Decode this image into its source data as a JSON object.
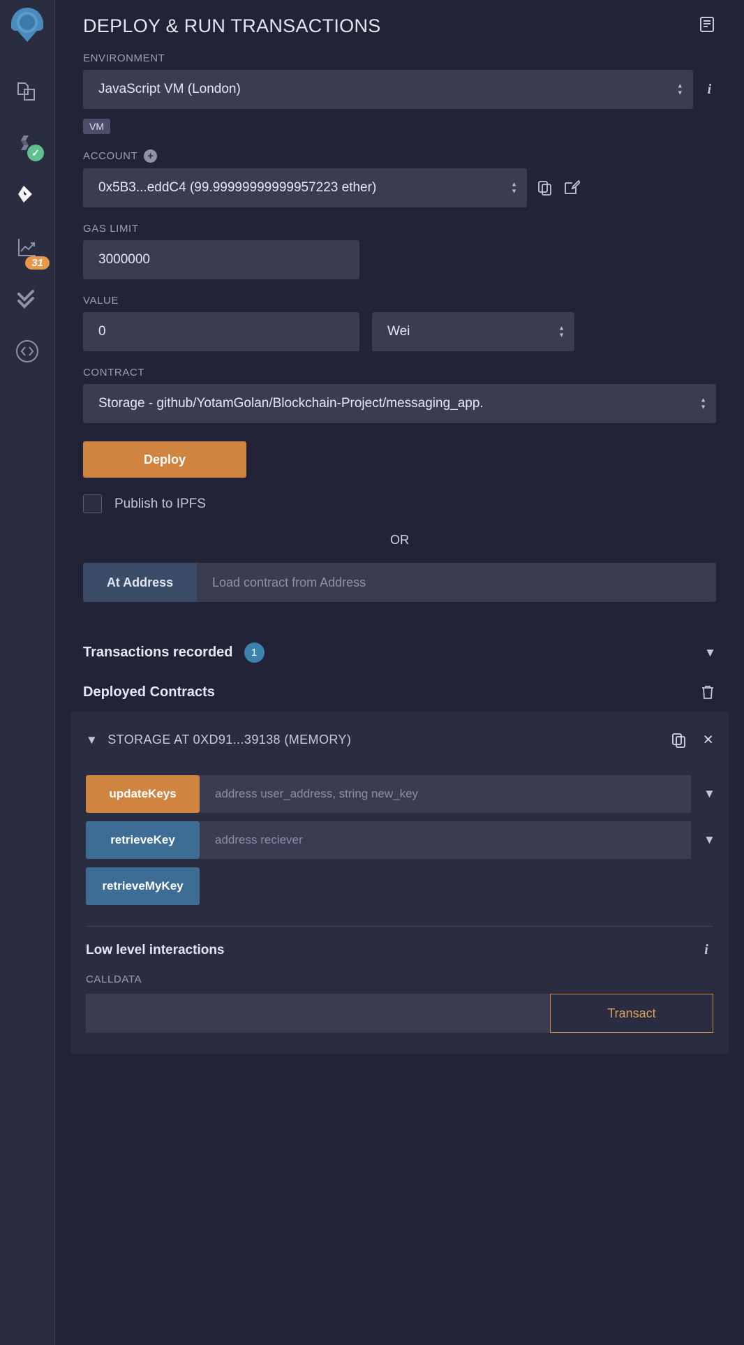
{
  "sidebar": {
    "items": [
      {
        "name": "remix-logo",
        "label": "Remix"
      },
      {
        "name": "file-explorers-icon",
        "label": "File explorers"
      },
      {
        "name": "solidity-compiler-icon",
        "label": "Solidity compiler",
        "badge": "✓"
      },
      {
        "name": "deploy-run-icon",
        "label": "Deploy & run transactions"
      },
      {
        "name": "debugger-icon",
        "label": "Debugger",
        "badge": "31"
      },
      {
        "name": "solidity-unit-testing-icon",
        "label": "Solidity unit testing"
      },
      {
        "name": "plugin-manager-icon",
        "label": "Plugin manager"
      }
    ]
  },
  "header": {
    "title": "DEPLOY & RUN TRANSACTIONS",
    "doc_icon": "document-icon"
  },
  "environment": {
    "label": "ENVIRONMENT",
    "value": "JavaScript VM (London)",
    "badge": "VM",
    "info_icon": "i"
  },
  "account": {
    "label": "ACCOUNT",
    "plus": "+",
    "value": "0x5B3...eddC4 (99.99999999999957223 ether)",
    "copy_icon": "copy-icon",
    "edit_icon": "edit-icon"
  },
  "gas_limit": {
    "label": "GAS LIMIT",
    "value": "3000000"
  },
  "value_field": {
    "label": "VALUE",
    "value": "0",
    "unit": "Wei"
  },
  "contract": {
    "label": "CONTRACT",
    "value": "Storage - github/YotamGolan/Blockchain-Project/messaging_app."
  },
  "deploy": {
    "button_label": "Deploy",
    "ipfs_label": "Publish to IPFS",
    "ipfs_checked": false,
    "or_label": "OR",
    "at_address_label": "At Address",
    "at_address_placeholder": "Load contract from Address"
  },
  "transactions": {
    "label": "Transactions recorded",
    "count": "1",
    "chevron": "chevron-down-icon"
  },
  "deployed": {
    "label": "Deployed Contracts",
    "trash_icon": "trash-icon",
    "instance": {
      "title": "STORAGE AT 0XD91...39138 (MEMORY)",
      "caret": "chevron-down-icon",
      "copy_icon": "copy-icon",
      "close_icon": "×",
      "functions": [
        {
          "name": "updateKeys",
          "style": "orange",
          "placeholder": "address user_address, string new_key",
          "expandable": true
        },
        {
          "name": "retrieveKey",
          "style": "blue",
          "placeholder": "address reciever",
          "expandable": true
        },
        {
          "name": "retrieveMyKey",
          "style": "blue",
          "placeholder": "",
          "expandable": false
        }
      ],
      "low_level": {
        "title": "Low level interactions",
        "info_icon": "i",
        "calldata_label": "CALLDATA",
        "calldata_value": "",
        "transact_label": "Transact"
      }
    }
  },
  "colors": {
    "accent_orange": "#cf8440",
    "accent_blue": "#3d6c94",
    "panel_bg": "#222336",
    "field_bg": "#3a3c52"
  }
}
